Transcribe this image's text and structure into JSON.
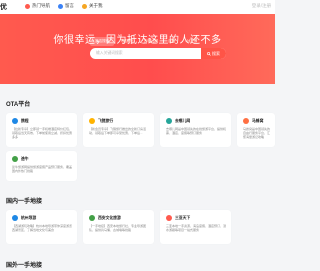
{
  "header": {
    "logo": "优",
    "nav": [
      {
        "label": "热门导航",
        "icon": "fire-icon",
        "color": "#ff5a4e"
      },
      {
        "label": "留言",
        "icon": "message-icon",
        "color": "#3b82f6"
      },
      {
        "label": "关于我",
        "icon": "user-icon",
        "color": "#f5a623"
      }
    ],
    "login_label": "登录/注册"
  },
  "hero": {
    "title": "你很幸运，因为抵达这里的人还不多",
    "tabs": [
      "酒店搜索",
      "飞猪旅行",
      "去哪儿网",
      "百度",
      "小红书"
    ],
    "active_tab": 0,
    "search_placeholder": "输入关键词搜索",
    "search_button": "搜索"
  },
  "sections": [
    {
      "title": "OTA平台",
      "cards": [
        {
          "name": "携程",
          "icon_color": "#1e88e5",
          "desc": "【拉新专享】立即领一手机端酒店特价红包，领取后当天有效，下单前使用立减，折扣优惠多多"
        },
        {
          "name": "飞猪旅行",
          "icon_color": "#ffb300",
          "desc": "【新会员专享】飞猪旅行推出的全新订房活动，领取后下单即可享受优惠，下单后..."
        },
        {
          "name": "去哪儿网",
          "icon_color": "#26a69a",
          "desc": "去哪儿网是中国领先的在线旅游平台，提供机票、酒店、度假等预订服务"
        },
        {
          "name": "马蜂窝",
          "icon_color": "#ff7043",
          "desc": "马蜂窝是中国领先的自由行服务平台，汇聚海量游记攻略"
        },
        {
          "name": "途牛",
          "icon_color": "#43a047",
          "desc": "途牛旅游网提供旅游度假产品预订服务，覆盖国内外热门线路"
        }
      ]
    },
    {
      "title": "国内一手地接",
      "cards": [
        {
          "name": "杭州导游",
          "icon_color": "#1e88e5",
          "desc": "【西湖游玩攻略】杭州本地导游带你深度游览西湖景区，了解当地文化与美食"
        },
        {
          "name": "西安文化旅游",
          "icon_color": "#43a047",
          "desc": "【一手地接】西安本地旅行社，专业导游团队，提供兵马俑、古城墙等线路"
        },
        {
          "name": "三亚天下",
          "icon_color": "#ff5a4e",
          "desc": "三亚本地一手资源，海岛度假、酒店预订、潜水游艇等项目一站式服务"
        }
      ]
    },
    {
      "title": "国外一手地接",
      "cards": []
    }
  ]
}
